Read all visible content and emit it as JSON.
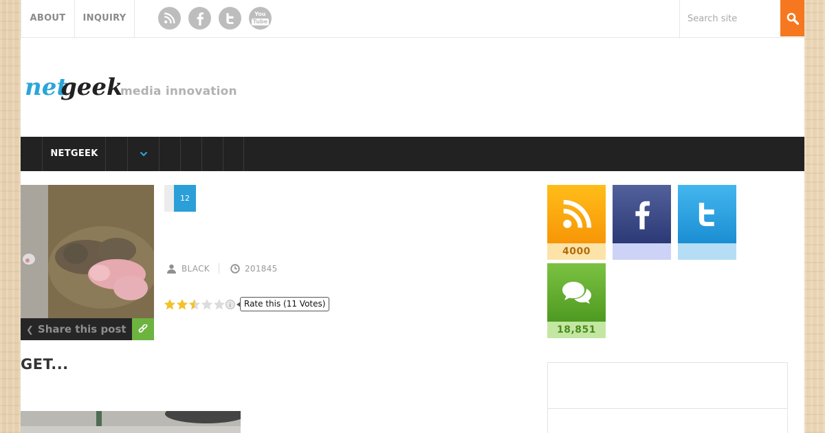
{
  "topbar": {
    "links": [
      "ABOUT",
      "INQUIRY"
    ],
    "social_icons": [
      "rss-icon",
      "facebook-icon",
      "twitter-icon",
      "youtube-icon"
    ],
    "youtube_text": "You\nTube",
    "search_placeholder": "Search site"
  },
  "brand": {
    "logo_text_blue": "net",
    "logo_text_dark": "geek",
    "tagline": "media innovation"
  },
  "nav": {
    "items": [
      "NETGEEK"
    ]
  },
  "post": {
    "comment_count": "12",
    "author": "BLACK",
    "views": "201845",
    "rating": {
      "stars_filled": 2.5,
      "stars_total": 5,
      "tooltip": "Rate this (11 Votes)"
    },
    "share_label": "Share this post",
    "title": "GET..."
  },
  "sidebar": {
    "rss_count": "4000",
    "comments_count": "18,851"
  },
  "colors": {
    "accent_orange": "#f57820",
    "accent_blue": "#2a9fd8",
    "accent_green": "#6db33f",
    "nav_bg": "#222222"
  }
}
